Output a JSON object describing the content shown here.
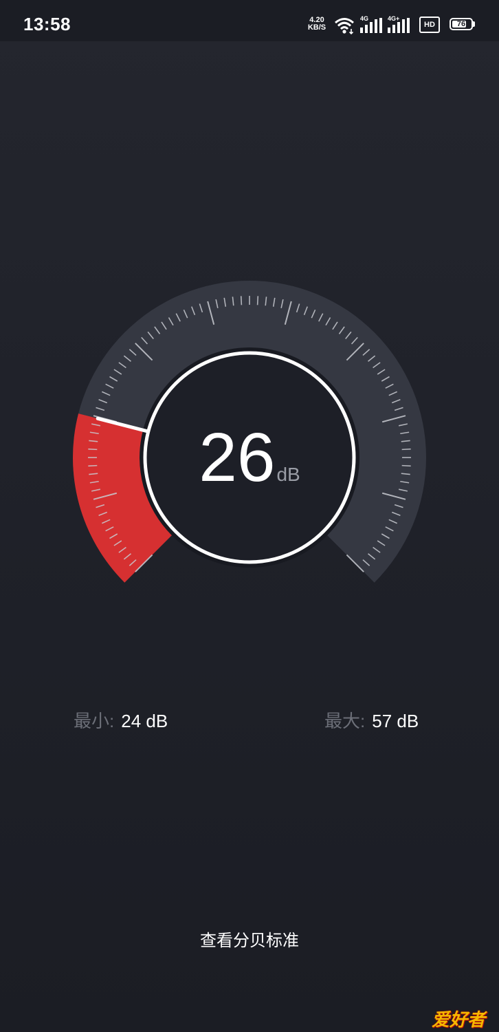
{
  "status_bar": {
    "time": "13:58",
    "net_speed_value": "4.20",
    "net_speed_unit": "KB/S",
    "sim1_label": "4G",
    "sim2_label": "4G+",
    "hd_label": "HD",
    "battery_level": "76",
    "icons": [
      "wifi-icon",
      "signal-icon",
      "signal-icon",
      "hd-icon",
      "battery-icon"
    ]
  },
  "meter": {
    "value": "26",
    "unit": "dB",
    "scale_max_db": 120,
    "level_fraction": 0.22,
    "colors": {
      "active_arc": "#d63031",
      "track_arc": "#353842",
      "ring": "#ffffff",
      "needle": "#ffffff",
      "ticks": "#c8cad0"
    }
  },
  "stats": {
    "min_label": "最小:",
    "min_value": "24 dB",
    "max_label": "最大:",
    "max_value": "57 dB"
  },
  "actions": {
    "view_standard_label": "查看分贝标准"
  },
  "watermark": {
    "text": "爱好者"
  }
}
